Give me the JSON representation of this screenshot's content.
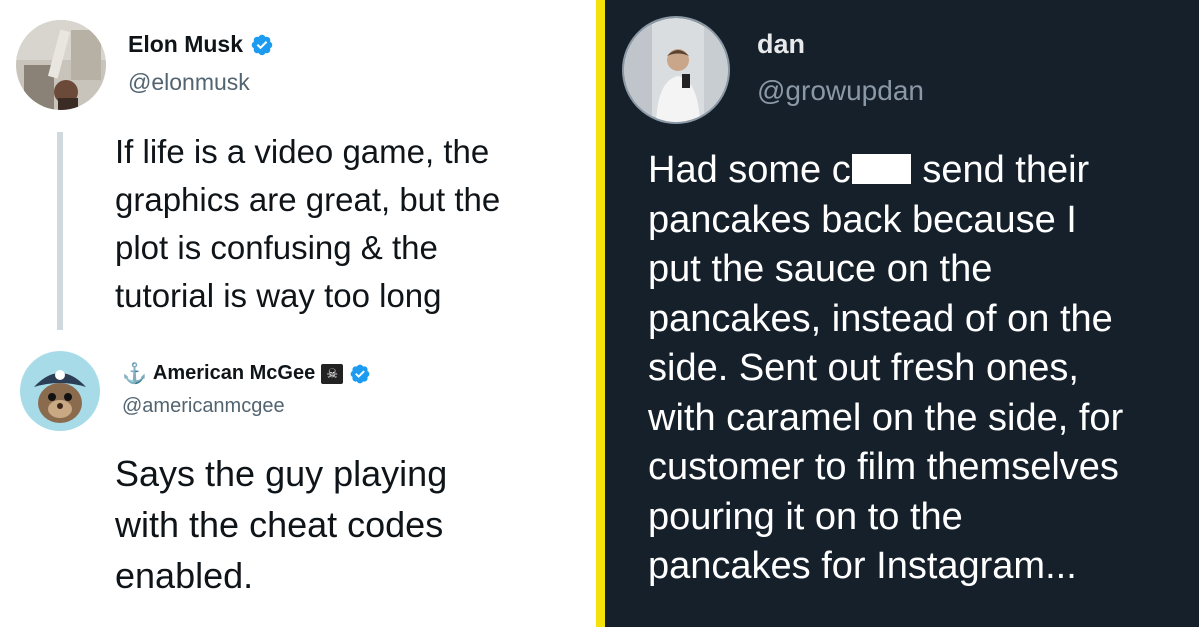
{
  "colors": {
    "divider": "#f5e20a",
    "dark_bg": "#15202b",
    "verified_blue": "#1d9bf0",
    "secondary_text": "#536471"
  },
  "elon_tweet": {
    "display_name": "Elon Musk",
    "handle": "@elonmusk",
    "verified_icon": "verified-badge-icon",
    "text": "If life is a video game, the\ngraphics are great, but the\nplot is confusing & the\ntutorial is way too long"
  },
  "mcgee_reply": {
    "name_prefix": "⚓",
    "display_name": "American McGee",
    "name_suffix": "☠",
    "handle": "@americanmcgee",
    "verified_icon": "verified-badge-icon",
    "text": "Says the guy playing\nwith the cheat codes\nenabled."
  },
  "dan_tweet": {
    "display_name": "dan",
    "handle": "@growupdan",
    "line1_before": "Had some c",
    "line1_after": "send their",
    "lines": [
      "pancakes back because I",
      "put the sauce on the",
      "pancakes, instead of on the",
      "side. Sent out fresh ones,",
      "with caramel on the side, for",
      "customer to film themselves",
      "pouring it on to the",
      "pancakes for Instagram..."
    ]
  }
}
